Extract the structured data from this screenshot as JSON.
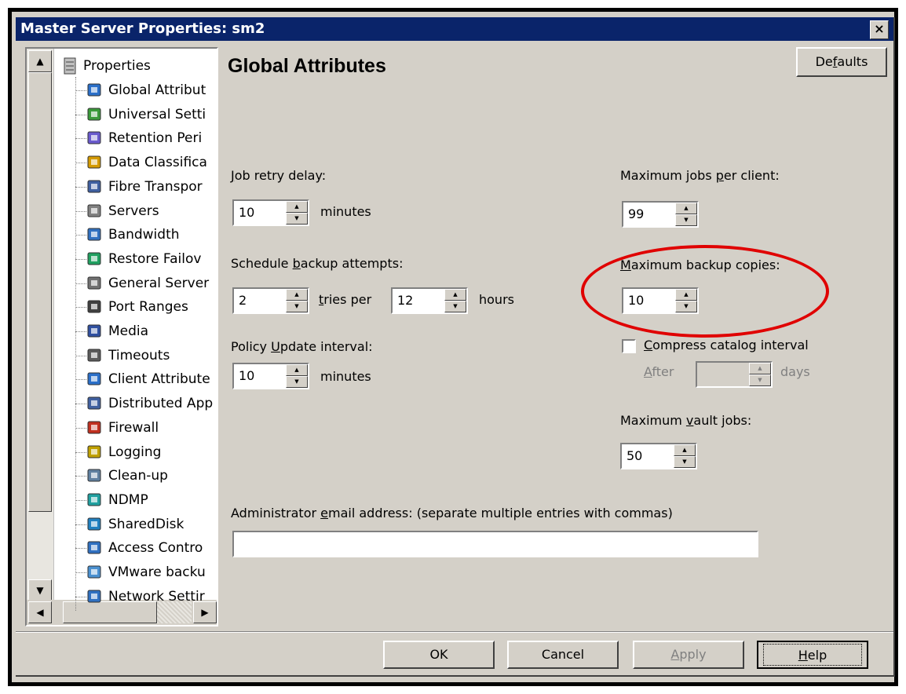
{
  "window": {
    "title": "Master Server Properties: sm2",
    "close_glyph": "×"
  },
  "tree": {
    "root_label": "Properties",
    "items": [
      {
        "label": "Global Attribut",
        "icon": "globe-icon"
      },
      {
        "label": "Universal Setti",
        "icon": "universal-settings-icon"
      },
      {
        "label": "Retention Peri",
        "icon": "retention-icon"
      },
      {
        "label": "Data Classifica",
        "icon": "data-classification-icon"
      },
      {
        "label": "Fibre Transpor",
        "icon": "fibre-transport-icon"
      },
      {
        "label": "Servers",
        "icon": "servers-icon"
      },
      {
        "label": "Bandwidth",
        "icon": "bandwidth-icon"
      },
      {
        "label": "Restore Failov",
        "icon": "restore-failover-icon"
      },
      {
        "label": "General Server",
        "icon": "general-server-icon"
      },
      {
        "label": "Port Ranges",
        "icon": "port-ranges-icon"
      },
      {
        "label": "Media",
        "icon": "media-icon"
      },
      {
        "label": "Timeouts",
        "icon": "timeouts-icon"
      },
      {
        "label": "Client Attribute",
        "icon": "client-attributes-icon"
      },
      {
        "label": "Distributed App",
        "icon": "distributed-app-icon"
      },
      {
        "label": "Firewall",
        "icon": "firewall-icon"
      },
      {
        "label": "Logging",
        "icon": "logging-icon"
      },
      {
        "label": "Clean-up",
        "icon": "clean-up-icon"
      },
      {
        "label": "NDMP",
        "icon": "ndmp-icon"
      },
      {
        "label": "SharedDisk",
        "icon": "shared-disk-icon"
      },
      {
        "label": "Access Contro",
        "icon": "access-control-icon"
      },
      {
        "label": "VMware backu",
        "icon": "vmware-backup-icon"
      },
      {
        "label": "Network Settir",
        "icon": "network-settings-icon"
      }
    ]
  },
  "main": {
    "heading": "Global Attributes",
    "defaults_button": {
      "pre": "De",
      "u": "f",
      "post": "aults"
    },
    "job_retry_delay": {
      "u": "J",
      "post": "ob retry delay:",
      "value": "10",
      "unit": "minutes"
    },
    "schedule_backup_attempts": {
      "pre": "Schedule ",
      "u": "b",
      "post": "ackup attempts:",
      "tries": "2",
      "tries_label_u": "t",
      "tries_label_post": "ries per",
      "hours_value": "12",
      "hours_label": "hours"
    },
    "policy_update_interval": {
      "pre": "Policy ",
      "u": "U",
      "post": "pdate interval:",
      "value": "10",
      "unit": "minutes"
    },
    "max_jobs_per_client": {
      "pre": "Maximum jobs ",
      "u": "p",
      "post": "er client:",
      "value": "99"
    },
    "max_backup_copies": {
      "u": "M",
      "post": "aximum backup copies:",
      "value": "10"
    },
    "compress_catalog": {
      "u": "C",
      "post": "ompress catalog interval",
      "checked": false,
      "after_u": "A",
      "after_post": "fter",
      "value": "",
      "unit": "days"
    },
    "max_vault_jobs": {
      "pre": "Maximum ",
      "u": "v",
      "post": "ault jobs:",
      "value": "50"
    },
    "admin_email": {
      "pre": "Administrator ",
      "u": "e",
      "post": "mail address: (separate multiple entries with commas)",
      "value": ""
    }
  },
  "footer": {
    "ok_label": "OK",
    "cancel_label": "Cancel",
    "apply": {
      "u": "A",
      "post": "pply"
    },
    "help": {
      "u": "H",
      "post": "elp"
    }
  },
  "highlight_color": "#e00000"
}
